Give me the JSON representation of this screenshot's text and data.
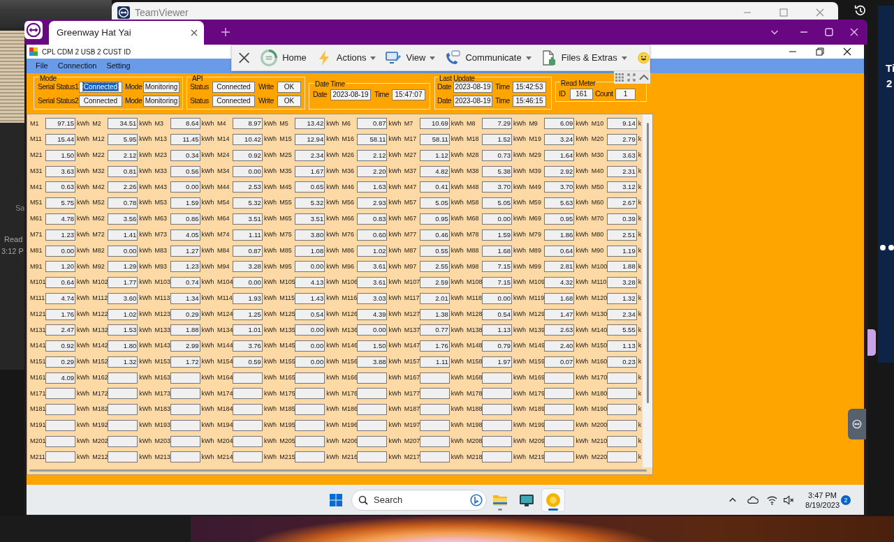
{
  "desktop": {
    "left_fragments": [
      "Sa",
      "Read",
      "3:12 P"
    ],
    "right_fragments": [
      "Ti",
      "2"
    ]
  },
  "background_window": {
    "title": "TeamViewer"
  },
  "teamviewer": {
    "tabs": [
      {
        "label": "Greenway Hat Yai",
        "selected": true
      }
    ],
    "toolbar": {
      "items": [
        {
          "label": "Home",
          "dropdown": false
        },
        {
          "label": "Actions",
          "dropdown": true
        },
        {
          "label": "View",
          "dropdown": true
        },
        {
          "label": "Communicate",
          "dropdown": true
        },
        {
          "label": "Files & Extras",
          "dropdown": true
        }
      ]
    }
  },
  "app": {
    "title": "CPL CDM 2 USB 2 CUST ID",
    "menu": [
      "File",
      "Connection",
      "Setting"
    ],
    "groups": [
      {
        "kind": "mode",
        "legend": "Mode",
        "rows": [
          {
            "fields": [
              {
                "label": "Serial Status1",
                "value": "Connected",
                "highlighted": true
              },
              {
                "label": "Mode",
                "value": "Monitoring",
                "highlighted": false
              }
            ]
          },
          {
            "fields": [
              {
                "label": "Serial Status2",
                "value": "Connected",
                "highlighted": false
              },
              {
                "label": "Mode",
                "value": "Monitoring",
                "highlighted": false
              }
            ]
          }
        ]
      },
      {
        "kind": "api",
        "legend": "API",
        "rows": [
          {
            "fields": [
              {
                "label": "Status",
                "value": "Connected",
                "highlighted": false
              },
              {
                "label": "Write",
                "value": "OK",
                "highlighted": false
              }
            ]
          },
          {
            "fields": [
              {
                "label": "Status",
                "value": "Connected",
                "highlighted": false
              },
              {
                "label": "Write",
                "value": "OK",
                "highlighted": false
              }
            ]
          }
        ]
      },
      {
        "kind": "date_time",
        "legend": "Date Time",
        "rows": [
          {
            "fields": [
              {
                "label": "Date",
                "value": "2023-08-19",
                "highlighted": false
              },
              {
                "label": "Time",
                "value": "15:47:07",
                "highlighted": false
              }
            ]
          }
        ]
      },
      {
        "kind": "last_update",
        "legend": "Last Update",
        "rows": [
          {
            "fields": [
              {
                "label": "Date",
                "value": "2023-08-19",
                "highlighted": false
              },
              {
                "label": "Time",
                "value": "15:42:53",
                "highlighted": false
              }
            ]
          },
          {
            "fields": [
              {
                "label": "Date",
                "value": "2023-08-19",
                "highlighted": false
              },
              {
                "label": "Time",
                "value": "15:46:15",
                "highlighted": false
              }
            ]
          }
        ]
      },
      {
        "kind": "read_meter",
        "legend": "Read Meter",
        "rows": [
          {
            "fields": [
              {
                "label": "ID",
                "value": "161",
                "highlighted": false
              },
              {
                "label": "Count",
                "value": "1",
                "highlighted": false
              }
            ]
          }
        ]
      }
    ],
    "meter_rows": [
      {
        "cells": [
          {
            "label": "M1",
            "value": "97.15",
            "unit": "kWh"
          },
          {
            "label": "M2",
            "value": "34.51",
            "unit": "kWh"
          },
          {
            "label": "M3",
            "value": "8.64",
            "unit": "kWh"
          },
          {
            "label": "M4",
            "value": "8.97",
            "unit": "kWh"
          },
          {
            "label": "M5",
            "value": "13.42",
            "unit": "kWh"
          },
          {
            "label": "M6",
            "value": "0.87",
            "unit": "kWh"
          },
          {
            "label": "M7",
            "value": "10.69",
            "unit": "kWh"
          },
          {
            "label": "M8",
            "value": "7.29",
            "unit": "kWh"
          },
          {
            "label": "M9",
            "value": "6.09",
            "unit": "kWh"
          },
          {
            "label": "M10",
            "value": "9.14",
            "unit": "k"
          }
        ]
      },
      {
        "cells": [
          {
            "label": "M11",
            "value": "15.44",
            "unit": "kWh"
          },
          {
            "label": "M12",
            "value": "5.95",
            "unit": "kWh"
          },
          {
            "label": "M13",
            "value": "11.45",
            "unit": "kWh"
          },
          {
            "label": "M14",
            "value": "10.42",
            "unit": "kWh"
          },
          {
            "label": "M15",
            "value": "12.94",
            "unit": "kWh"
          },
          {
            "label": "M16",
            "value": "58.11",
            "unit": "kWh"
          },
          {
            "label": "M17",
            "value": "58.11",
            "unit": "kWh"
          },
          {
            "label": "M18",
            "value": "1.52",
            "unit": "kWh"
          },
          {
            "label": "M19",
            "value": "3.24",
            "unit": "kWh"
          },
          {
            "label": "M20",
            "value": "2.79",
            "unit": "k"
          }
        ]
      },
      {
        "cells": [
          {
            "label": "M21",
            "value": "1.50",
            "unit": "kWh"
          },
          {
            "label": "M22",
            "value": "2.12",
            "unit": "kWh"
          },
          {
            "label": "M23",
            "value": "0.34",
            "unit": "kWh"
          },
          {
            "label": "M24",
            "value": "0.92",
            "unit": "kWh"
          },
          {
            "label": "M25",
            "value": "2.34",
            "unit": "kWh"
          },
          {
            "label": "M26",
            "value": "2.12",
            "unit": "kWh"
          },
          {
            "label": "M27",
            "value": "1.12",
            "unit": "kWh"
          },
          {
            "label": "M28",
            "value": "0.73",
            "unit": "kWh"
          },
          {
            "label": "M29",
            "value": "1.64",
            "unit": "kWh"
          },
          {
            "label": "M30",
            "value": "3.63",
            "unit": "k"
          }
        ]
      },
      {
        "cells": [
          {
            "label": "M31",
            "value": "3.63",
            "unit": "kWh"
          },
          {
            "label": "M32",
            "value": "0.81",
            "unit": "kWh"
          },
          {
            "label": "M33",
            "value": "0.56",
            "unit": "kWh"
          },
          {
            "label": "M34",
            "value": "0.00",
            "unit": "kWh"
          },
          {
            "label": "M35",
            "value": "1.67",
            "unit": "kWh"
          },
          {
            "label": "M36",
            "value": "2.20",
            "unit": "kWh"
          },
          {
            "label": "M37",
            "value": "4.82",
            "unit": "kWh"
          },
          {
            "label": "M38",
            "value": "5.38",
            "unit": "kWh"
          },
          {
            "label": "M39",
            "value": "2.92",
            "unit": "kWh"
          },
          {
            "label": "M40",
            "value": "2.31",
            "unit": "k"
          }
        ]
      },
      {
        "cells": [
          {
            "label": "M41",
            "value": "0.63",
            "unit": "kWh"
          },
          {
            "label": "M42",
            "value": "2.26",
            "unit": "kWh"
          },
          {
            "label": "M43",
            "value": "0.00",
            "unit": "kWh"
          },
          {
            "label": "M44",
            "value": "2.53",
            "unit": "kWh"
          },
          {
            "label": "M45",
            "value": "0.65",
            "unit": "kWh"
          },
          {
            "label": "M46",
            "value": "1.63",
            "unit": "kWh"
          },
          {
            "label": "M47",
            "value": "0.41",
            "unit": "kWh"
          },
          {
            "label": "M48",
            "value": "3.70",
            "unit": "kWh"
          },
          {
            "label": "M49",
            "value": "3.70",
            "unit": "kWh"
          },
          {
            "label": "M50",
            "value": "3.12",
            "unit": "k"
          }
        ]
      },
      {
        "cells": [
          {
            "label": "M51",
            "value": "5.75",
            "unit": "kWh"
          },
          {
            "label": "M52",
            "value": "0.78",
            "unit": "kWh"
          },
          {
            "label": "M53",
            "value": "1.59",
            "unit": "kWh"
          },
          {
            "label": "M54",
            "value": "5.32",
            "unit": "kWh"
          },
          {
            "label": "M55",
            "value": "5.32",
            "unit": "kWh"
          },
          {
            "label": "M56",
            "value": "2.93",
            "unit": "kWh"
          },
          {
            "label": "M57",
            "value": "5.05",
            "unit": "kWh"
          },
          {
            "label": "M58",
            "value": "5.05",
            "unit": "kWh"
          },
          {
            "label": "M59",
            "value": "5.63",
            "unit": "kWh"
          },
          {
            "label": "M60",
            "value": "2.67",
            "unit": "k"
          }
        ]
      },
      {
        "cells": [
          {
            "label": "M61",
            "value": "4.78",
            "unit": "kWh"
          },
          {
            "label": "M62",
            "value": "3.56",
            "unit": "kWh"
          },
          {
            "label": "M63",
            "value": "0.86",
            "unit": "kWh"
          },
          {
            "label": "M64",
            "value": "3.51",
            "unit": "kWh"
          },
          {
            "label": "M65",
            "value": "3.51",
            "unit": "kWh"
          },
          {
            "label": "M66",
            "value": "0.83",
            "unit": "kWh"
          },
          {
            "label": "M67",
            "value": "0.95",
            "unit": "kWh"
          },
          {
            "label": "M68",
            "value": "0.00",
            "unit": "kWh"
          },
          {
            "label": "M69",
            "value": "0.95",
            "unit": "kWh"
          },
          {
            "label": "M70",
            "value": "0.39",
            "unit": "k"
          }
        ]
      },
      {
        "cells": [
          {
            "label": "M71",
            "value": "1.23",
            "unit": "kWh"
          },
          {
            "label": "M72",
            "value": "1.41",
            "unit": "kWh"
          },
          {
            "label": "M73",
            "value": "4.05",
            "unit": "kWh"
          },
          {
            "label": "M74",
            "value": "1.11",
            "unit": "kWh"
          },
          {
            "label": "M75",
            "value": "3.80",
            "unit": "kWh"
          },
          {
            "label": "M76",
            "value": "0.60",
            "unit": "kWh"
          },
          {
            "label": "M77",
            "value": "0.46",
            "unit": "kWh"
          },
          {
            "label": "M78",
            "value": "1.59",
            "unit": "kWh"
          },
          {
            "label": "M79",
            "value": "1.86",
            "unit": "kWh"
          },
          {
            "label": "M80",
            "value": "2.51",
            "unit": "k"
          }
        ]
      },
      {
        "cells": [
          {
            "label": "M81",
            "value": "0.00",
            "unit": "kWh"
          },
          {
            "label": "M82",
            "value": "0.00",
            "unit": "kWh"
          },
          {
            "label": "M83",
            "value": "1.27",
            "unit": "kWh"
          },
          {
            "label": "M84",
            "value": "0.87",
            "unit": "kWh"
          },
          {
            "label": "M85",
            "value": "1.08",
            "unit": "kWh"
          },
          {
            "label": "M86",
            "value": "1.02",
            "unit": "kWh"
          },
          {
            "label": "M87",
            "value": "0.55",
            "unit": "kWh"
          },
          {
            "label": "M88",
            "value": "1.68",
            "unit": "kWh"
          },
          {
            "label": "M89",
            "value": "0.64",
            "unit": "kWh"
          },
          {
            "label": "M90",
            "value": "1.19",
            "unit": "k"
          }
        ]
      },
      {
        "cells": [
          {
            "label": "M91",
            "value": "1.20",
            "unit": "kWh"
          },
          {
            "label": "M92",
            "value": "1.29",
            "unit": "kWh"
          },
          {
            "label": "M93",
            "value": "1.23",
            "unit": "kWh"
          },
          {
            "label": "M94",
            "value": "3.28",
            "unit": "kWh"
          },
          {
            "label": "M95",
            "value": "0.00",
            "unit": "kWh"
          },
          {
            "label": "M96",
            "value": "3.61",
            "unit": "kWh"
          },
          {
            "label": "M97",
            "value": "2.55",
            "unit": "kWh"
          },
          {
            "label": "M98",
            "value": "7.15",
            "unit": "kWh"
          },
          {
            "label": "M99",
            "value": "2.81",
            "unit": "kWh"
          },
          {
            "label": "M100",
            "value": "1.88",
            "unit": "k"
          }
        ]
      },
      {
        "cells": [
          {
            "label": "M101",
            "value": "0.64",
            "unit": "kWh"
          },
          {
            "label": "M102",
            "value": "1.77",
            "unit": "kWh"
          },
          {
            "label": "M103",
            "value": "0.74",
            "unit": "kWh"
          },
          {
            "label": "M104",
            "value": "0.00",
            "unit": "kWh"
          },
          {
            "label": "M105",
            "value": "4.13",
            "unit": "kWh"
          },
          {
            "label": "M106",
            "value": "3.61",
            "unit": "kWh"
          },
          {
            "label": "M107",
            "value": "2.59",
            "unit": "kWh"
          },
          {
            "label": "M108",
            "value": "7.15",
            "unit": "kWh"
          },
          {
            "label": "M109",
            "value": "4.32",
            "unit": "kWh"
          },
          {
            "label": "M110",
            "value": "3.28",
            "unit": "k"
          }
        ]
      },
      {
        "cells": [
          {
            "label": "M111",
            "value": "4.74",
            "unit": "kWh"
          },
          {
            "label": "M112",
            "value": "3.60",
            "unit": "kWh"
          },
          {
            "label": "M113",
            "value": "1.34",
            "unit": "kWh"
          },
          {
            "label": "M114",
            "value": "1.93",
            "unit": "kWh"
          },
          {
            "label": "M115",
            "value": "1.43",
            "unit": "kWh"
          },
          {
            "label": "M116",
            "value": "3.03",
            "unit": "kWh"
          },
          {
            "label": "M117",
            "value": "2.01",
            "unit": "kWh"
          },
          {
            "label": "M118",
            "value": "0.00",
            "unit": "kWh"
          },
          {
            "label": "M119",
            "value": "1.68",
            "unit": "kWh"
          },
          {
            "label": "M120",
            "value": "1.32",
            "unit": "k"
          }
        ]
      },
      {
        "cells": [
          {
            "label": "M121",
            "value": "1.76",
            "unit": "kWh"
          },
          {
            "label": "M122",
            "value": "1.02",
            "unit": "kWh"
          },
          {
            "label": "M123",
            "value": "0.29",
            "unit": "kWh"
          },
          {
            "label": "M124",
            "value": "1.25",
            "unit": "kWh"
          },
          {
            "label": "M125",
            "value": "0.54",
            "unit": "kWh"
          },
          {
            "label": "M126",
            "value": "4.39",
            "unit": "kWh"
          },
          {
            "label": "M127",
            "value": "1.38",
            "unit": "kWh"
          },
          {
            "label": "M128",
            "value": "0.54",
            "unit": "kWh"
          },
          {
            "label": "M129",
            "value": "1.47",
            "unit": "kWh"
          },
          {
            "label": "M130",
            "value": "2.34",
            "unit": "k"
          }
        ]
      },
      {
        "cells": [
          {
            "label": "M131",
            "value": "2.47",
            "unit": "kWh"
          },
          {
            "label": "M132",
            "value": "1.53",
            "unit": "kWh"
          },
          {
            "label": "M133",
            "value": "1.88",
            "unit": "kWh"
          },
          {
            "label": "M134",
            "value": "1.01",
            "unit": "kWh"
          },
          {
            "label": "M135",
            "value": "0.00",
            "unit": "kWh"
          },
          {
            "label": "M136",
            "value": "0.00",
            "unit": "kWh"
          },
          {
            "label": "M137",
            "value": "0.77",
            "unit": "kWh"
          },
          {
            "label": "M138",
            "value": "1.13",
            "unit": "kWh"
          },
          {
            "label": "M139",
            "value": "2.63",
            "unit": "kWh"
          },
          {
            "label": "M140",
            "value": "5.55",
            "unit": "k"
          }
        ]
      },
      {
        "cells": [
          {
            "label": "M141",
            "value": "0.92",
            "unit": "kWh"
          },
          {
            "label": "M142",
            "value": "1.80",
            "unit": "kWh"
          },
          {
            "label": "M143",
            "value": "2.99",
            "unit": "kWh"
          },
          {
            "label": "M144",
            "value": "3.76",
            "unit": "kWh"
          },
          {
            "label": "M145",
            "value": "0.00",
            "unit": "kWh"
          },
          {
            "label": "M146",
            "value": "1.50",
            "unit": "kWh"
          },
          {
            "label": "M147",
            "value": "1.76",
            "unit": "kWh"
          },
          {
            "label": "M148",
            "value": "0.79",
            "unit": "kWh"
          },
          {
            "label": "M149",
            "value": "2.40",
            "unit": "kWh"
          },
          {
            "label": "M150",
            "value": "1.13",
            "unit": "k"
          }
        ]
      },
      {
        "cells": [
          {
            "label": "M151",
            "value": "0.29",
            "unit": "kWh"
          },
          {
            "label": "M152",
            "value": "1.32",
            "unit": "kWh"
          },
          {
            "label": "M153",
            "value": "1.72",
            "unit": "kWh"
          },
          {
            "label": "M154",
            "value": "0.59",
            "unit": "kWh"
          },
          {
            "label": "M155",
            "value": "0.00",
            "unit": "kWh"
          },
          {
            "label": "M156",
            "value": "3.88",
            "unit": "kWh"
          },
          {
            "label": "M157",
            "value": "1.11",
            "unit": "kWh"
          },
          {
            "label": "M158",
            "value": "1.97",
            "unit": "kWh"
          },
          {
            "label": "M159",
            "value": "0.07",
            "unit": "kWh"
          },
          {
            "label": "M160",
            "value": "0.23",
            "unit": "k"
          }
        ]
      },
      {
        "cells": [
          {
            "label": "M161",
            "value": "4.09",
            "unit": "kWh"
          },
          {
            "label": "M162",
            "unit": "kWh"
          },
          {
            "label": "M163",
            "unit": "kWh"
          },
          {
            "label": "M164",
            "unit": "kWh"
          },
          {
            "label": "M165",
            "unit": "kWh"
          },
          {
            "label": "M166",
            "unit": "kWh"
          },
          {
            "label": "M167",
            "unit": "kWh"
          },
          {
            "label": "M168",
            "unit": "kWh"
          },
          {
            "label": "M169",
            "unit": "kWh"
          },
          {
            "label": "M170",
            "unit": "k"
          }
        ]
      },
      {
        "cells": [
          {
            "label": "M171",
            "unit": "kWh"
          },
          {
            "label": "M172",
            "unit": "kWh"
          },
          {
            "label": "M173",
            "unit": "kWh"
          },
          {
            "label": "M174",
            "unit": "kWh"
          },
          {
            "label": "M175",
            "unit": "kWh"
          },
          {
            "label": "M176",
            "unit": "kWh"
          },
          {
            "label": "M177",
            "unit": "kWh"
          },
          {
            "label": "M178",
            "unit": "kWh"
          },
          {
            "label": "M179",
            "unit": "kWh"
          },
          {
            "label": "M180",
            "unit": "k"
          }
        ]
      },
      {
        "cells": [
          {
            "label": "M181",
            "unit": "kWh"
          },
          {
            "label": "M182",
            "unit": "kWh"
          },
          {
            "label": "M183",
            "unit": "kWh"
          },
          {
            "label": "M184",
            "unit": "kWh"
          },
          {
            "label": "M185",
            "unit": "kWh"
          },
          {
            "label": "M186",
            "unit": "kWh"
          },
          {
            "label": "M187",
            "unit": "kWh"
          },
          {
            "label": "M188",
            "unit": "kWh"
          },
          {
            "label": "M189",
            "unit": "kWh"
          },
          {
            "label": "M190",
            "unit": "k"
          }
        ]
      },
      {
        "cells": [
          {
            "label": "M191",
            "unit": "kWh"
          },
          {
            "label": "M192",
            "unit": "kWh"
          },
          {
            "label": "M193",
            "unit": "kWh"
          },
          {
            "label": "M194",
            "unit": "kWh"
          },
          {
            "label": "M195",
            "unit": "kWh"
          },
          {
            "label": "M196",
            "unit": "kWh"
          },
          {
            "label": "M197",
            "unit": "kWh"
          },
          {
            "label": "M198",
            "unit": "kWh"
          },
          {
            "label": "M199",
            "unit": "kWh"
          },
          {
            "label": "M200",
            "unit": "k"
          }
        ]
      },
      {
        "cells": [
          {
            "label": "M201",
            "unit": "kWh"
          },
          {
            "label": "M202",
            "unit": "kWh"
          },
          {
            "label": "M203",
            "unit": "kWh"
          },
          {
            "label": "M204",
            "unit": "kWh"
          },
          {
            "label": "M205",
            "unit": "kWh"
          },
          {
            "label": "M206",
            "unit": "kWh"
          },
          {
            "label": "M207",
            "unit": "kWh"
          },
          {
            "label": "M208",
            "unit": "kWh"
          },
          {
            "label": "M209",
            "unit": "kWh"
          },
          {
            "label": "M210",
            "unit": "k"
          }
        ]
      },
      {
        "cells": [
          {
            "label": "M211",
            "unit": "kWh"
          },
          {
            "label": "M212",
            "unit": "kWh"
          },
          {
            "label": "M213",
            "unit": "kWh"
          },
          {
            "label": "M214",
            "unit": "kWh"
          },
          {
            "label": "M215",
            "unit": "kWh"
          },
          {
            "label": "M216",
            "unit": "kWh"
          },
          {
            "label": "M217",
            "unit": "kWh"
          },
          {
            "label": "M218",
            "unit": "kWh"
          },
          {
            "label": "M219",
            "unit": "kWh"
          },
          {
            "label": "M220",
            "unit": "k"
          }
        ]
      }
    ]
  },
  "taskbar": {
    "search": {
      "placeholder": "Search"
    },
    "apps": [
      {
        "running": true,
        "selected": false
      },
      {
        "running": false,
        "selected": false
      },
      {
        "running": true,
        "selected": true
      }
    ],
    "time": "3:47 PM",
    "date": "8/19/2023",
    "notification_count": "2"
  }
}
